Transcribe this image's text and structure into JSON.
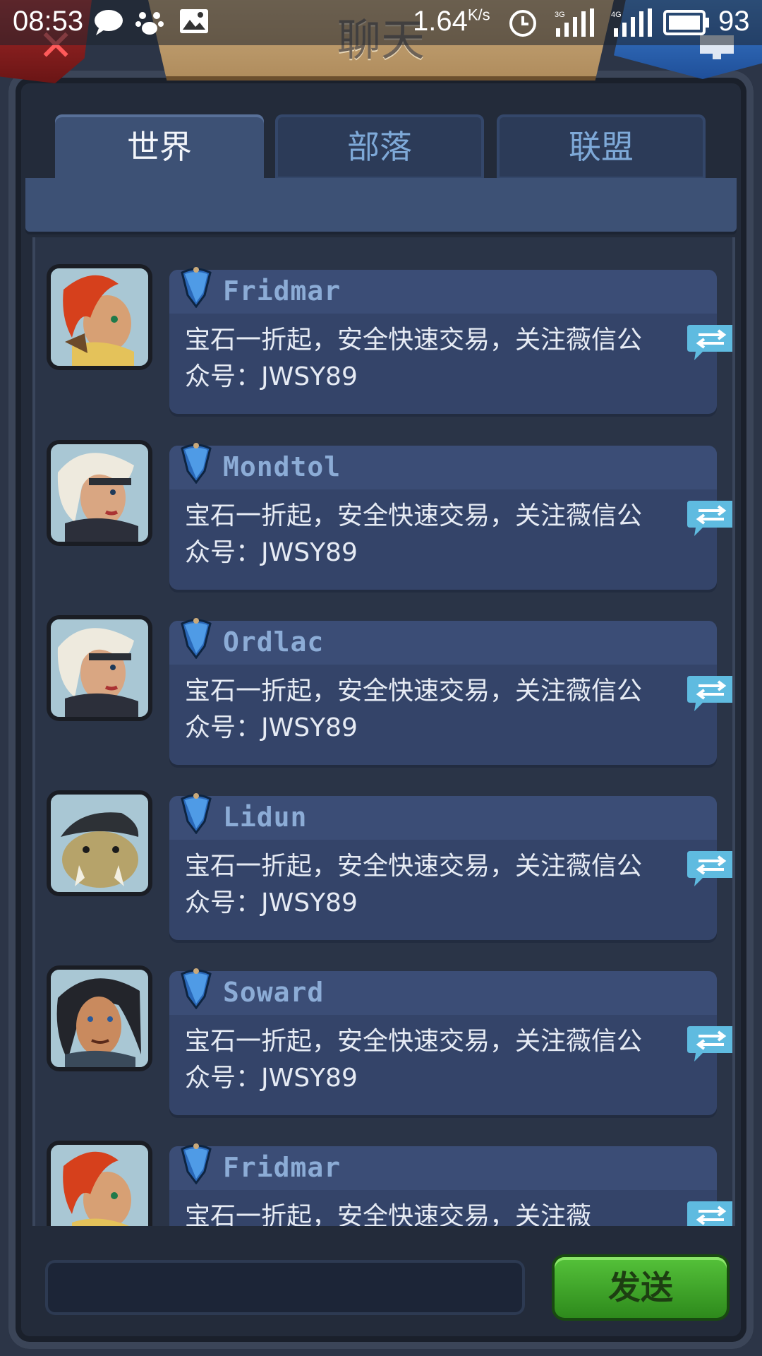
{
  "status_bar": {
    "time": "08:53",
    "net_speed": "1.64",
    "net_speed_unit": "K/s",
    "network_3g": "3G",
    "network_4g": "4G",
    "battery": "93"
  },
  "header": {
    "title": "聊天"
  },
  "tabs": [
    {
      "label": "世界",
      "active": true
    },
    {
      "label": "部落",
      "active": false
    },
    {
      "label": "联盟",
      "active": false
    }
  ],
  "messages": [
    {
      "sender": "Fridmar",
      "text": "宝石一折起，安全快速交易，关注薇信公众号：JWSY89",
      "avatar": "red-hair-warrior-avatar"
    },
    {
      "sender": "Mondtol",
      "text": "宝石一折起，安全快速交易，关注薇信公众号：JWSY89",
      "avatar": "white-hair-woman-avatar"
    },
    {
      "sender": "Ordlac",
      "text": "宝石一折起，安全快速交易，关注薇信公众号：JWSY89",
      "avatar": "white-hair-woman-avatar"
    },
    {
      "sender": "Lidun",
      "text": "宝石一折起，安全快速交易，关注薇信公众号：JWSY89",
      "avatar": "beast-avatar"
    },
    {
      "sender": "Soward",
      "text": "宝石一折起，安全快速交易，关注薇信公众号：JWSY89",
      "avatar": "dark-hair-man-avatar"
    },
    {
      "sender": "Fridmar",
      "text": "宝石一折起，安全快速交易，关注薇",
      "avatar": "red-hair-warrior-avatar"
    }
  ],
  "composer": {
    "input_value": "",
    "send_label": "发送"
  },
  "colors": {
    "accent_green": "#3aa82a",
    "tab_active": "#3d5175",
    "sender_text": "#8cacd6"
  }
}
